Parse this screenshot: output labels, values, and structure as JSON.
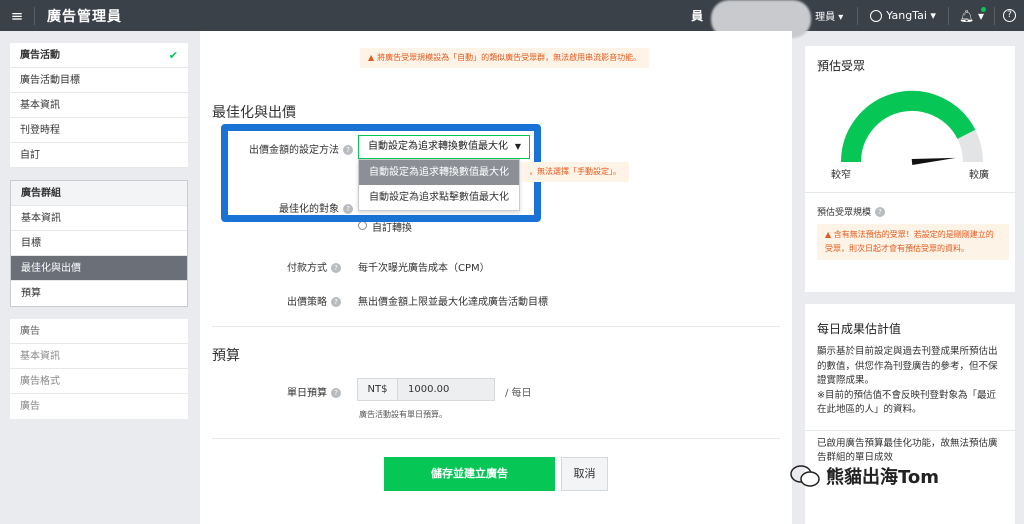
{
  "topbar": {
    "app_title": "廣告管理員",
    "account_label": "員",
    "account_right": "理員",
    "user_name": "YangTai"
  },
  "sidebar": {
    "campaign": {
      "head": "廣告活動",
      "items": [
        "廣告活動目標",
        "基本資訊",
        "刊登時程",
        "自訂"
      ]
    },
    "adgroup": {
      "head": "廣告群組",
      "items": [
        "基本資訊",
        "目標",
        "最佳化與出價",
        "預算"
      ]
    },
    "ad": {
      "head": "廣告",
      "items": [
        "基本資訊",
        "廣告格式",
        "廣告"
      ]
    }
  },
  "main": {
    "top_warning": "將廣告受眾規模設為「自動」的類似廣告受眾群，無法啟用串流影音功能。",
    "optimization": {
      "title": "最佳化與出價",
      "bid_method_label": "出價金額的設定方法",
      "bid_method_value": "自動設定為追求轉換數值最大化",
      "dropdown_options": [
        "自動設定為追求轉換數值最大化",
        "自動設定為追求點擊數值最大化"
      ],
      "side_warning": "，無法選擇「手動設定」。",
      "target_label": "最佳化的對象",
      "custom_conversion": "自訂轉換",
      "payment_label": "付款方式",
      "payment_value": "每千次曝光廣告成本（CPM）",
      "strategy_label": "出價策略",
      "strategy_value": "無出價金額上限並最大化達成廣告活動目標"
    },
    "budget": {
      "title": "預算",
      "daily_label": "單日預算",
      "currency": "NT$",
      "amount": "1000.00",
      "per_day": "/ 每日",
      "hint": "廣告活動設有單日預算。"
    },
    "save_button": "儲存並建立廣告",
    "cancel_button": "取消"
  },
  "audience_panel": {
    "title": "預估受眾",
    "narrow": "較窄",
    "wide": "較廣",
    "gauge_level": 0.85,
    "size_label": "預估受眾規模",
    "warning": "含有無法預估的受眾！若設定的是剛剛建立的受眾，則次日起才會有預估受眾的資料。"
  },
  "daily_panel": {
    "title": "每日成果估計值",
    "paragraph1": "顯示基於目前設定與過去刊登成果所預估出的數值，供您作為刊登廣告的參考，但不保證實際成果。",
    "paragraph2": "※目前的預估值不會反映刊登對象為「最近在此地區的人」的資料。",
    "paragraph3": "已啟用廣告預算最佳化功能，故無法預估廣告群組的單日成效"
  },
  "watermark": "熊貓出海Tom",
  "colors": {
    "accent_green": "#06c755",
    "highlight_blue": "#1a73d4",
    "warning_orange": "#e25a1c",
    "topbar": "#3b4148"
  }
}
